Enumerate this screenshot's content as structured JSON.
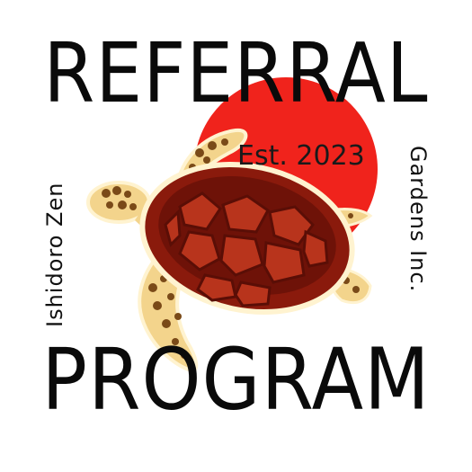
{
  "poster": {
    "title_top": "REFERRAL",
    "title_bottom": "PROGRAM",
    "established": "Est. 2023",
    "side_left": "Ishidoro Zen",
    "side_right": "Gardens Inc."
  },
  "colors": {
    "sun": "#f0231c",
    "shell": "#8a1a0c",
    "shell_scute": "#b8341c",
    "skin": "#f3d48c",
    "skin_spots": "#7a4a18"
  },
  "icons": [
    "sea-turtle-icon",
    "rising-sun-icon"
  ]
}
